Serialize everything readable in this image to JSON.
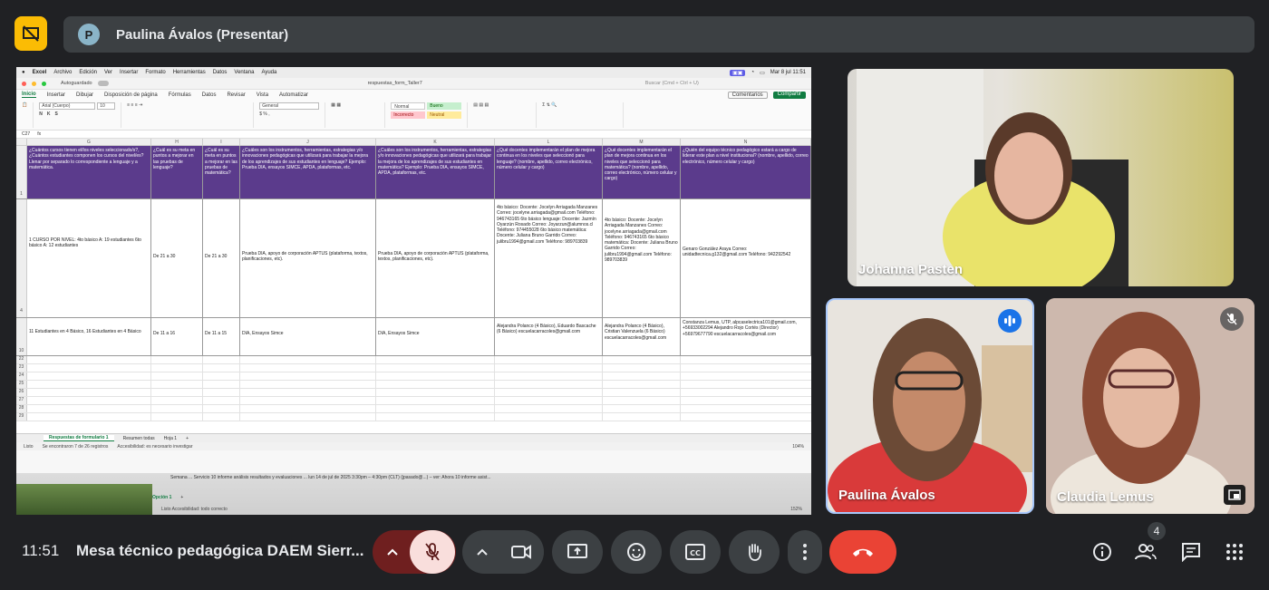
{
  "presenter": {
    "initial": "P",
    "label": "Paulina Ávalos (Presentar)"
  },
  "mac_menu": {
    "app": "Excel",
    "items": [
      "Archivo",
      "Edición",
      "Ver",
      "Insertar",
      "Formato",
      "Herramientas",
      "Datos",
      "Ventana",
      "Ayuda"
    ],
    "datetime": "Mar 8 jul 11:51"
  },
  "excel": {
    "autosave": "Autoguardado",
    "filename": "respuestas_form_Taller7",
    "search_placeholder": "Buscar (Cmd + Ctrl + U)",
    "tabs": [
      "Inicio",
      "Insertar",
      "Dibujar",
      "Disposición de página",
      "Fórmulas",
      "Datos",
      "Revisar",
      "Vista",
      "Automatizar"
    ],
    "comment_btn": "Comentarios",
    "share_btn": "Compartir",
    "font_name": "Arial (Cuerpo)",
    "font_size": "10",
    "number_format": "General",
    "styles": [
      "Normal",
      "Bueno",
      "Incorrecto",
      "Neutral"
    ],
    "cell_ref": "C27",
    "fx": "fx",
    "columns": [
      "G",
      "H",
      "I",
      "J",
      "K",
      "L",
      "M",
      "N"
    ],
    "headers": [
      "¿Cuántos cursos tienen el/los niveles seleccionado/s?, ¿Cuántos estudiantes componen los cursos del nivel/es? Llenar por separado lo correspondiente a lenguaje y a matemática.",
      "¿Cuál es su meta en puntos a mejorar en las pruebas de lenguaje?",
      "¿Cuál es su meta en puntos a mejorar en las pruebas de matemática?",
      "¿Cuáles son los instrumentos, herramientas, estrategias y/o innovaciones pedagógicas que utilizará para trabajar la mejora de los aprendizajes de sus estudiantes en lenguaje? Ejemplo: Prueba DIA, ensayos SIMCE, APDA, plataformas, etc.",
      "¿Cuáles son los instrumentos, herramientas, estrategias y/o innovaciones pedagógicas que utilizará para trabajar la mejora de los aprendizajes de sus estudiantes en matemática? Ejemplo: Prueba DIA, ensayos SIMCE, APDA, plataformas, etc.",
      "¿Qué docentes implementarán el plan de mejora continua en los niveles que seleccionó para lenguaje? (nombre, apellido, correo electrónico, número celular y cargo)",
      "¿Qué docentes implementarán el plan de mejora continua en los niveles que seleccionó para matemática? (nombre, apellido, correo electrónico, número celular y cargo)",
      "¿Quién del equipo técnico pedagógico estará a cargo de liderar este plan a nivel institucional? (nombre, apellido, correo electrónico, número celular y cargo)"
    ],
    "row4": [
      "1 CURSO POR NIVEL: 4to básico A: 19 estudiantes 6to básico A: 12 estudiantes",
      "De 21 a 30",
      "De 21 a 30",
      "Prueba DIA, apoyo de corporación APTUS (plataforma, textos, planificaciones, etc).",
      "Prueba DIA, apoyo de corporación APTUS (plataforma, textos, planificaciones, etc).",
      "4to básico: Docente: Jocelyn Arriagada Manzanes Correo: jocelyne.arriagada@gmail.com Teléfono: 946743165 6to básico lenguaje: Docente: Jazmín Oyarzún Rosado Correo: Joyarzun@alumnos.cl Teléfono: 974455028 6to básico matemática: Docente: Juliana Bruno Garrido Correo: julibru1994@gmail.com Teléfono: 989703839",
      "4to básico: Docente: Jocelyn Arriagada Manzanes Correo: jocelyne.arriagada@gmail.com Teléfono: 946743165 6to básico matemática: Docente: Juliana Bruno Garrido Correo: julibru1994@gmail.com Teléfono: 989703839",
      "Genaro González Araya Correo: unidadtecnica.g132@gmail.com Teléfono: 942292542"
    ],
    "row10": [
      "11 Estudiantes en 4 Básico, 16 Estudiantes en 4 Básico",
      "De 11 a 16",
      "De 11 a 15",
      "DIA, Ensayos Simce",
      "DIA, Ensayos Simce",
      "Alejandra Polanco (4 Básico), Eduardo Bascache (6 Básico) escuelacarracoles@gmail.com",
      "Alejandra Polanco (4 Básico), Cristian Valenzuela (6 Básico) escuelacarracoles@gmail.com",
      "Constanza Lemus, UTP, alpcaselectrica101@gmail.com, +56933002294 Alejandro Rojo Cortés (Director) +56979677790 escuelacarracoles@gmail.com"
    ],
    "row_numbers": [
      "1",
      "4",
      "10",
      "22",
      "23",
      "24",
      "25",
      "26",
      "27",
      "28",
      "29"
    ],
    "sheet_tabs": [
      "Respuestas de formulario 1",
      "Resumen todas",
      "Hoja 1"
    ],
    "status_left": "Listo",
    "status_filter": "Se encontraron 7 de 26 registros",
    "status_access": "Accesibilidad: es necesario investigar",
    "zoom": "104%",
    "under_text": "Semana ... Servicio 10 informe análisis resultados y evaluaciones ... lun 14 de jul de 2025 3:30pm – 4:30pm (CLT) (jpasado@...) – ver: Ahora 10 informe asist...",
    "under_tabs": [
      "Opción 1"
    ],
    "under_status": "Listo    Accesibilidad: todo correcto",
    "under_zoom": "152%"
  },
  "participants": [
    {
      "name": "Johanna Pasten",
      "badge": ""
    },
    {
      "name": "Paulina Ávalos",
      "badge": "speaking-icon"
    },
    {
      "name": "Claudia Lemus",
      "badge": "mic-off-icon"
    }
  ],
  "bottom": {
    "time": "11:51",
    "meeting_title": "Mesa técnico pedagógica DAEM Sierr...",
    "people_count": "4"
  },
  "colors": {
    "end_call": "#ea4335",
    "mic_off": "#f9dedc",
    "active_tile_border": "#a8c7fa",
    "sheet_header": "#5b3b8c"
  }
}
